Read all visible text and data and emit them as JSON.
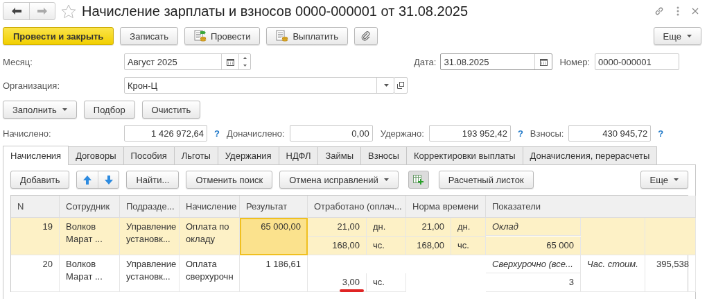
{
  "window": {
    "title": "Начисление зарплаты и взносов 0000-000001 от 31.08.2025"
  },
  "toolbar": [
    {
      "kind": "primary",
      "label": "Провести и закрыть"
    },
    {
      "kind": "plain",
      "label": "Записать"
    },
    {
      "kind": "post",
      "label": "Провести"
    },
    {
      "kind": "pay",
      "label": "Выплатить"
    },
    {
      "kind": "attach"
    }
  ],
  "toolbar_more": "Еще",
  "month": {
    "label": "Месяц:",
    "value": "Август 2025"
  },
  "date": {
    "label": "Дата:",
    "value": "31.08.2025"
  },
  "number": {
    "label": "Номер:",
    "value": "0000-000001"
  },
  "organization": {
    "label": "Организация:",
    "value": "Крон-Ц"
  },
  "fill_buttons": [
    {
      "label": "Заполнить",
      "dropdown": true
    },
    {
      "label": "Подбор",
      "dropdown": false
    },
    {
      "label": "Очистить",
      "dropdown": false
    }
  ],
  "totals": [
    {
      "label": "Начислено:",
      "value": "1 426 972,64",
      "help": "?"
    },
    {
      "label": "Доначислено:",
      "value": "0,00"
    },
    {
      "label": "Удержано:",
      "value": "193 952,42",
      "help": "?"
    },
    {
      "label": "Взносы:",
      "value": "430 945,72",
      "help": "?"
    }
  ],
  "tabs": [
    {
      "label": "Начисления",
      "selected": true
    },
    {
      "label": "Договоры",
      "selected": false
    },
    {
      "label": "Пособия",
      "selected": false
    },
    {
      "label": "Льготы",
      "selected": false
    },
    {
      "label": "Удержания",
      "selected": false
    },
    {
      "label": "НДФЛ",
      "selected": false
    },
    {
      "label": "Займы",
      "selected": false
    },
    {
      "label": "Взносы",
      "selected": false
    },
    {
      "label": "Корректировки выплаты",
      "selected": false
    },
    {
      "label": "Доначисления, перерасчеты",
      "selected": false
    }
  ],
  "table_toolbar": [
    {
      "kind": "text",
      "label": "Добавить"
    },
    {
      "kind": "move"
    },
    {
      "kind": "text",
      "label": "Найти..."
    },
    {
      "kind": "text",
      "label": "Отменить поиск"
    },
    {
      "kind": "dropdown",
      "label": "Отмена исправлений"
    },
    {
      "kind": "add-column"
    },
    {
      "kind": "text",
      "label": "Расчетный листок"
    }
  ],
  "table_more": "Еще",
  "table": {
    "columns": [
      "N",
      "Сотрудник",
      "Подразде...",
      "Начисление",
      "Результат",
      "Отработано (оплач...",
      "Норма времени",
      "Показатели"
    ],
    "rows": [
      {
        "n": "19",
        "employee": "Волков Марат ...",
        "department": "Управление установк...",
        "accrual": "Оплата по окладу",
        "result": "65 000,00",
        "selected": true,
        "worked_upper": {
          "value": "21,00",
          "unit": "дн."
        },
        "worked_lower": {
          "value": "168,00",
          "unit": "чс."
        },
        "norm_upper": {
          "value": "21,00",
          "unit": "дн."
        },
        "norm_lower": {
          "value": "168,00",
          "unit": "чс."
        },
        "indicator_name": "Оклад",
        "indicator_value": "65 000"
      },
      {
        "n": "20",
        "employee": "Волков Марат ...",
        "department": "Управление установк...",
        "accrual": "Оплата сверхурочн",
        "result": "1 186,61",
        "selected": false,
        "worked_lower": {
          "value": "3,00",
          "unit": "чс.",
          "underlined": true
        },
        "indicator_name": "Сверхурочно (все...",
        "indicator_value": "3",
        "indicator_2": "Час. стоим.",
        "indicator_3": "395,538"
      }
    ]
  }
}
